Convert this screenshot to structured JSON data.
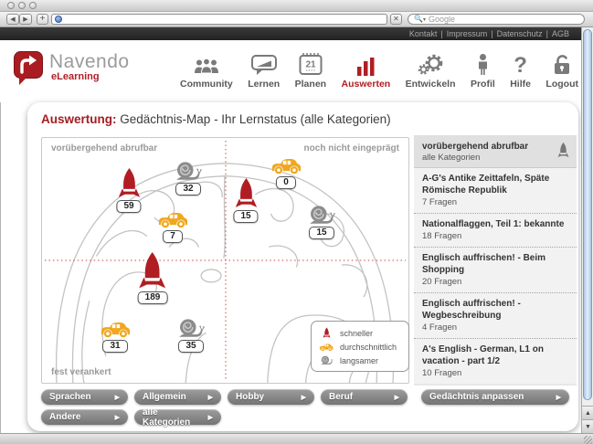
{
  "browser": {
    "search_label": "Google",
    "topbar_links": [
      "Kontakt",
      "Impressum",
      "Datenschutz",
      "AGB"
    ],
    "separator": "|"
  },
  "brand": {
    "name": "Navendo",
    "tagline": "eLearning"
  },
  "nav": {
    "items": [
      {
        "label": "Community"
      },
      {
        "label": "Lernen"
      },
      {
        "label": "Planen",
        "calendar_day": "21"
      },
      {
        "label": "Auswerten",
        "active": true
      },
      {
        "label": "Entwickeln"
      },
      {
        "label": "Profil"
      },
      {
        "label": "Hilfe"
      },
      {
        "label": "Logout"
      }
    ]
  },
  "page": {
    "title_label": "Auswertung:",
    "title_text": "Gedächtnis-Map - Ihr Lernstatus (alle Kategorien)"
  },
  "map": {
    "label_top_left": "vorübergehend abrufbar",
    "label_top_right": "noch nicht eingeprägt",
    "label_bottom_left": "fest verankert",
    "markers": [
      {
        "type": "rocket",
        "value": "59"
      },
      {
        "type": "snail",
        "value": "32"
      },
      {
        "type": "car",
        "value": "7"
      },
      {
        "type": "rocket",
        "value": "15"
      },
      {
        "type": "car",
        "value": "0"
      },
      {
        "type": "snail",
        "value": "15"
      },
      {
        "type": "rocket",
        "value": "189"
      },
      {
        "type": "car",
        "value": "31"
      },
      {
        "type": "snail",
        "value": "35"
      }
    ],
    "legend": [
      {
        "icon": "rocket",
        "label": "schneller"
      },
      {
        "icon": "car",
        "label": "durchschnittlich"
      },
      {
        "icon": "snail",
        "label": "langsamer"
      }
    ]
  },
  "sidebar": {
    "header_title": "vorübergehend abrufbar",
    "header_subtitle": "alle Kategorien",
    "items": [
      {
        "title": "A-G's Antike Zeittafeln, Späte Römische Republik",
        "count": "7 Fragen"
      },
      {
        "title": "Nationalflaggen, Teil 1: bekannte",
        "count": "18 Fragen"
      },
      {
        "title": "Englisch auffrischen! - Beim Shopping",
        "count": "20 Fragen"
      },
      {
        "title": "Englisch auffrischen! - Wegbeschreibung",
        "count": "4 Fragen"
      },
      {
        "title": "A's English - German, L1 on vacation - part 1/2",
        "count": "10 Fragen"
      }
    ],
    "action_button": "Gedächtnis anpassen"
  },
  "categories": [
    {
      "label": "Sprachen"
    },
    {
      "label": "Allgemein"
    },
    {
      "label": "Hobby"
    },
    {
      "label": "Beruf"
    },
    {
      "label": "Andere"
    },
    {
      "label": "alle Kategorien"
    }
  ],
  "icons": {
    "question_mark": "?",
    "arrow_right": "▶",
    "back": "◀",
    "forward": "▶",
    "plus": "+",
    "close": "✕",
    "up": "▲",
    "down": "▼",
    "search_menu": "▾"
  },
  "colors": {
    "accent_red": "#b01e23",
    "car_yellow": "#f0a71f",
    "snail_gray": "#8c8c8c",
    "nav_gray": "#7a7a7a"
  }
}
